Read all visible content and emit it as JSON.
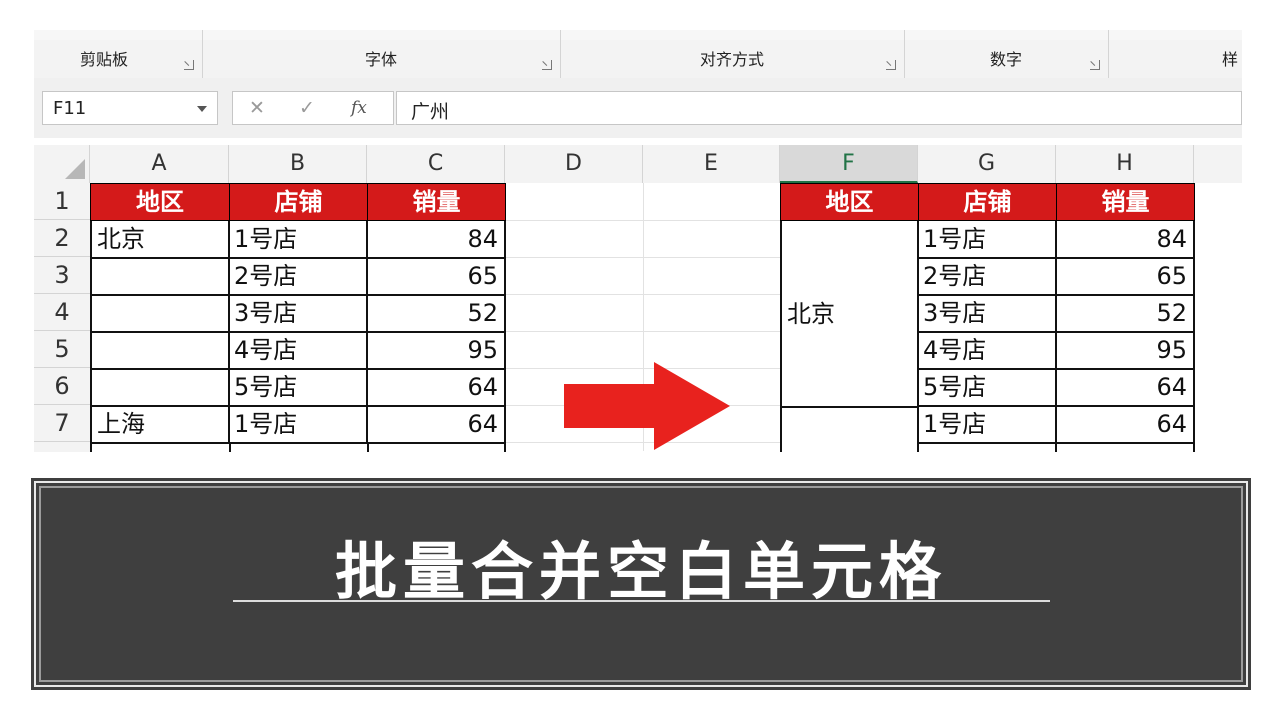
{
  "ribbon": {
    "groups": [
      {
        "label": "剪贴板"
      },
      {
        "label": "字体"
      },
      {
        "label": "对齐方式"
      },
      {
        "label": "数字"
      },
      {
        "label": "样"
      }
    ]
  },
  "formula_bar": {
    "name_box": "F11",
    "cancel_glyph": "✕",
    "enter_glyph": "✓",
    "fx_glyph": "fx",
    "value": "广州"
  },
  "columns": [
    "A",
    "B",
    "C",
    "D",
    "E",
    "F",
    "G",
    "H"
  ],
  "active_column": "F",
  "rows": [
    "1",
    "2",
    "3",
    "4",
    "5",
    "6",
    "7"
  ],
  "left_table": {
    "headers": [
      "地区",
      "店铺",
      "销量"
    ],
    "region_cells": [
      "北京",
      "",
      "",
      "",
      "",
      "上海"
    ],
    "store_cells": [
      "1号店",
      "2号店",
      "3号店",
      "4号店",
      "5号店",
      "1号店"
    ],
    "sales_cells": [
      "84",
      "65",
      "52",
      "95",
      "64",
      "64"
    ]
  },
  "right_table": {
    "headers": [
      "地区",
      "店铺",
      "销量"
    ],
    "merged_region": "北京",
    "store_cells": [
      "1号店",
      "2号店",
      "3号店",
      "4号店",
      "5号店",
      "1号店"
    ],
    "sales_cells": [
      "84",
      "65",
      "52",
      "95",
      "64",
      "64"
    ]
  },
  "colors": {
    "header_red": "#d41a1a",
    "arrow_red": "#e8221e",
    "banner_bg": "#3f3f3f",
    "excel_green": "#217346"
  },
  "banner": {
    "title": "批量合并空白单元格"
  }
}
